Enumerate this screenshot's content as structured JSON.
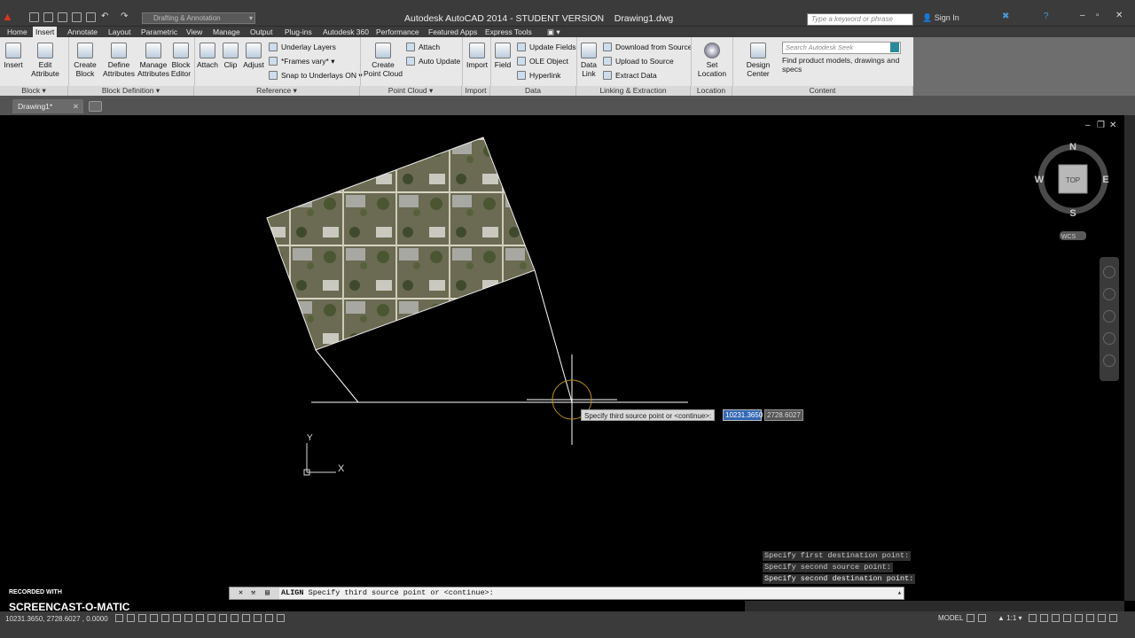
{
  "window": {
    "title": "Autodesk AutoCAD 2014 - STUDENT VERSION    Drawing1.dwg",
    "workspace": "Drafting & Annotation",
    "search_placeholder": "Type a keyword or phrase",
    "sign_in": "Sign In"
  },
  "ribbon_tabs": [
    "Home",
    "Insert",
    "Annotate",
    "Layout",
    "Parametric",
    "View",
    "Manage",
    "Output",
    "Plug-ins",
    "Autodesk 360",
    "Performance",
    "Featured Apps",
    "Express Tools"
  ],
  "active_tab": "Insert",
  "ribbon": {
    "insert": "Insert",
    "edit_attribute_1": "Edit",
    "edit_attribute_2": "Attribute",
    "create_block_1": "Create",
    "create_block_2": "Block",
    "define_attributes_1": "Define",
    "define_attributes_2": "Attributes",
    "manage_attributes_1": "Manage",
    "manage_attributes_2": "Attributes",
    "block_editor_1": "Block",
    "block_editor_2": "Editor",
    "attach": "Attach",
    "clip": "Clip",
    "adjust": "Adjust",
    "underlay_layers": "Underlay Layers",
    "frames_vary": "*Frames vary*",
    "snap_to_underlays": "Snap to Underlays ON",
    "create_point_cloud_1": "Create",
    "create_point_cloud_2": "Point Cloud",
    "pc_attach": "Attach",
    "auto_update": "Auto Update",
    "import": "Import",
    "field": "Field",
    "update_fields": "Update Fields",
    "ole_object": "OLE Object",
    "hyperlink": "Hyperlink",
    "data_link_1": "Data",
    "data_link_2": "Link",
    "download_from_source": "Download from Source",
    "upload_to_source": "Upload to Source",
    "extract_data": "Extract  Data",
    "set_location_1": "Set",
    "set_location_2": "Location",
    "design_center": "Design Center",
    "seek_placeholder": "Search Autodesk Seek",
    "seek_help": "Find product models, drawings and specs",
    "panels": {
      "block": "Block",
      "block_definition": "Block Definition",
      "reference": "Reference",
      "point_cloud": "Point Cloud",
      "import": "Import",
      "data": "Data",
      "linking": "Linking & Extraction",
      "location": "Location",
      "content": "Content"
    }
  },
  "document_tab": "Drawing1*",
  "viewcube": {
    "n": "N",
    "s": "S",
    "e": "E",
    "w": "W",
    "face": "TOP",
    "ucs": "WCS"
  },
  "ucs_icon": {
    "x": "X",
    "y": "Y"
  },
  "dynamic_input": {
    "prompt": "Specify third source point or <continue>:",
    "x_value": "10231.3650",
    "y_value": "2728.6027"
  },
  "command_history": [
    "Specify first destination point:",
    "Specify second source point:",
    "Specify second destination point:"
  ],
  "command_line": {
    "command": "ALIGN",
    "text": " Specify third source point or <continue>:"
  },
  "status": {
    "coordinates": "10231.3650, 2728.6027 , 0.0000",
    "model": "MODEL",
    "scale": "1:1"
  },
  "overlay": {
    "recorded_with": "RECORDED WITH",
    "brand": "SCREENCAST-O-MATIC"
  },
  "colors": {
    "background": "#000000",
    "ribbon": "#e8e8e8",
    "chrome": "#3b3b3b",
    "input_highlight": "#3367b5"
  }
}
